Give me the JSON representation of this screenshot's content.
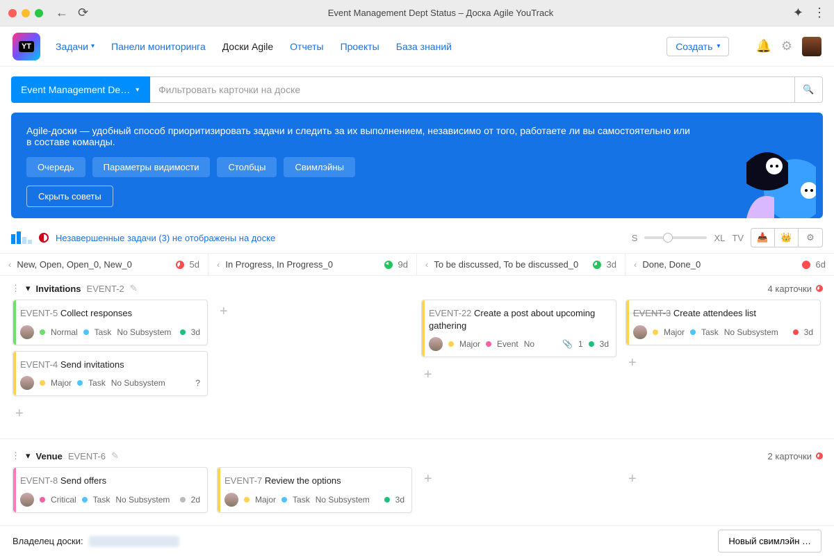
{
  "chrome": {
    "title": "Event Management Dept Status – Доска Agile YouTrack"
  },
  "nav": {
    "issues": "Задачи",
    "dashboards": "Панели мониторинга",
    "agile": "Доски Agile",
    "reports": "Отчеты",
    "projects": "Проекты",
    "knowledge": "База знаний",
    "create": "Создать"
  },
  "board": {
    "selected": "Event Management De…",
    "filter_placeholder": "Фильтровать карточки на доске"
  },
  "banner": {
    "text": "Agile-доски — удобный способ приоритизировать задачи и следить за их выполнением, независимо от того, работаете ли вы самостоятельно или в составе команды.",
    "b1": "Очередь",
    "b2": "Параметры видимости",
    "b3": "Столбцы",
    "b4": "Свимлэйны",
    "hide": "Скрыть советы"
  },
  "toolrow": {
    "warning": "Незавершенные задачи (3) не отображены на доске",
    "size_s": "S",
    "size_xl": "XL",
    "tv": "TV"
  },
  "columns": [
    {
      "title": "New, Open, Open_0, New_0",
      "age": "5d",
      "dot": "d-red"
    },
    {
      "title": "In Progress, In Progress_0",
      "age": "9d",
      "dot": "d-green"
    },
    {
      "title": "To be discussed, To be discussed_0",
      "age": "3d",
      "dot": "d-green2"
    },
    {
      "title": "Done, Done_0",
      "age": "6d",
      "dot": "d-red-full"
    }
  ],
  "lanes": [
    {
      "title": "Invitations",
      "code": "EVENT-2",
      "count": "4 карточки",
      "cells": [
        [
          {
            "code": "EVENT-5",
            "title": "Collect responses",
            "stripe": "stripe-green",
            "meta": [
              {
                "d": "pd-green",
                "t": "Normal"
              },
              {
                "d": "pd-blue",
                "t": "Task"
              },
              {
                "t": "No Subsystem"
              }
            ],
            "right": [
              {
                "d": "pd-teal",
                "t": "3d"
              }
            ]
          },
          {
            "code": "EVENT-4",
            "title": "Send invitations",
            "stripe": "stripe-yellow",
            "meta": [
              {
                "d": "pd-yellow",
                "t": "Major"
              },
              {
                "d": "pd-blue",
                "t": "Task"
              },
              {
                "t": "No Subsystem"
              }
            ],
            "right": [
              {
                "t": "?"
              }
            ]
          }
        ],
        [],
        [
          {
            "code": "EVENT-22",
            "title": "Create a post about upcoming gathering",
            "stripe": "stripe-yellow",
            "meta": [
              {
                "d": "pd-yellow",
                "t": "Major"
              },
              {
                "d": "pd-pink",
                "t": "Event"
              },
              {
                "t": "No"
              }
            ],
            "right": [
              {
                "icon": "📎",
                "t": "1"
              },
              {
                "d": "pd-teal",
                "t": "3d"
              }
            ]
          }
        ],
        [
          {
            "code": "EVENT-3",
            "done": true,
            "title": "Create attendees list",
            "stripe": "stripe-yellow",
            "meta": [
              {
                "d": "pd-yellow",
                "t": "Major"
              },
              {
                "d": "pd-blue",
                "t": "Task"
              },
              {
                "t": "No Subsystem"
              }
            ],
            "right": [
              {
                "d": "pd-red",
                "t": "3d"
              }
            ]
          }
        ]
      ]
    },
    {
      "title": "Venue",
      "code": "EVENT-6",
      "count": "2 карточки",
      "cells": [
        [
          {
            "code": "EVENT-8",
            "title": "Send offers",
            "stripe": "stripe-pink",
            "meta": [
              {
                "d": "pd-pink",
                "t": "Critical"
              },
              {
                "d": "pd-blue",
                "t": "Task"
              },
              {
                "t": "No Subsystem"
              }
            ],
            "right": [
              {
                "d": "pd-gray",
                "t": "2d"
              }
            ]
          }
        ],
        [
          {
            "code": "EVENT-7",
            "title": "Review the options",
            "stripe": "stripe-yellow",
            "meta": [
              {
                "d": "pd-yellow",
                "t": "Major"
              },
              {
                "d": "pd-blue",
                "t": "Task"
              },
              {
                "t": "No Subsystem"
              }
            ],
            "right": [
              {
                "d": "pd-teal",
                "t": "3d"
              }
            ]
          }
        ],
        [],
        []
      ]
    }
  ],
  "footer": {
    "owner_label": "Владелец доски:",
    "new_lane": "Новый свимлэйн …"
  }
}
